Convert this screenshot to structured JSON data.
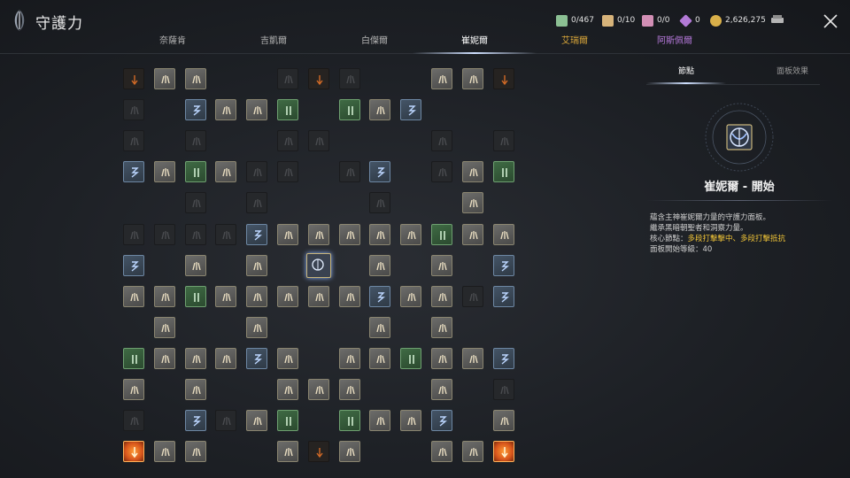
{
  "header": {
    "title": "守護力",
    "resources": [
      {
        "icon": "green-tome-icon",
        "value": "0/467",
        "color": "#8bbf93"
      },
      {
        "icon": "parchment-icon",
        "value": "0/10",
        "color": "#d7b37a"
      },
      {
        "icon": "pink-scroll-icon",
        "value": "0/0",
        "color": "#d28fb5"
      },
      {
        "icon": "purple-crystal-icon",
        "value": "0",
        "color": "#b27ad6"
      },
      {
        "icon": "gold-coin-icon",
        "value": "2,626,275",
        "color": "#d9b04a"
      }
    ]
  },
  "tabs": [
    {
      "label": "奈薩肯",
      "state": "normal"
    },
    {
      "label": "吉凱爾",
      "state": "normal"
    },
    {
      "label": "白傑爾",
      "state": "normal"
    },
    {
      "label": "崔妮爾",
      "state": "active"
    },
    {
      "label": "艾瑞爾",
      "state": "gold"
    },
    {
      "label": "阿斯佩爾",
      "state": "purple"
    }
  ],
  "grid_rows": [
    "oLL_DoD_LLo",
    "D_BLLG_GLB_D",
    "D_D_DD_D_D",
    "BLGLDD_DB_DLG",
    "_D_D_D_L_",
    "DDDDBLLLLLGLL",
    "B_L_L_C_L_L_B",
    "LLGLLLLLBLLDB",
    "_L__L__L__L__",
    "GLLLBL_LLGLLB",
    "L_L_LLL_L_D",
    "D_BDLG_GLLB_L",
    "FLL_LoL_LLF"
  ],
  "panel": {
    "tabs": [
      {
        "label": "節點",
        "active": true
      },
      {
        "label": "面板效果",
        "active": false
      }
    ],
    "node_title": "崔妮爾 - 開始",
    "desc_lines": [
      [
        {
          "t": "蘊含主神崔妮爾力量的守護力面板。",
          "hl": false
        }
      ],
      [
        {
          "t": "繼承黑暗朝聖者和洞察力量。",
          "hl": false
        }
      ],
      [
        {
          "t": "核心節點：",
          "hl": false
        },
        {
          "t": "多段打擊擊中、多段打擊抵抗",
          "hl": true
        }
      ],
      [
        {
          "t": "面板開始等級：40",
          "hl": false
        }
      ]
    ]
  }
}
